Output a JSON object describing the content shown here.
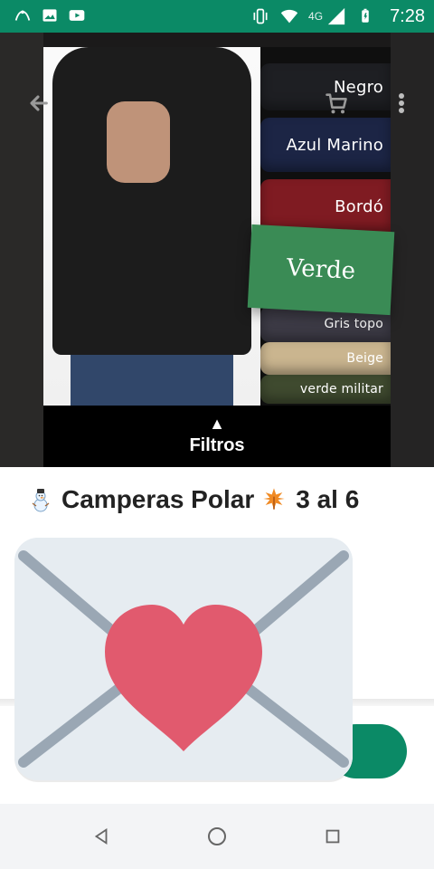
{
  "status_bar": {
    "time": "7:28",
    "network": "4G",
    "icons": [
      "assistant-icon",
      "image-icon",
      "youtube-icon",
      "vibrate-icon",
      "wifi-icon",
      "signal-icon",
      "battery-icon"
    ]
  },
  "hero": {
    "swatches": [
      {
        "label": "Negro",
        "color": "#1e1f23"
      },
      {
        "label": "Azul Marino",
        "color": "#1c2545"
      },
      {
        "label": "Bordó",
        "color": "#7f1b22"
      },
      {
        "label": "Verde",
        "color": "#3a8b55"
      },
      {
        "label": "Gris topo",
        "color": "#3d3b46"
      },
      {
        "label": "Beige",
        "color": "#cab58f"
      },
      {
        "label": "verde militar",
        "color": "#3f4a2f"
      }
    ],
    "filters_label": "Filtros"
  },
  "top_controls": {
    "back_icon": "arrow-back-icon",
    "cart_icon": "shopping-cart-icon",
    "menu_icon": "more-vert-icon"
  },
  "content": {
    "title_prefix_emoji": "snowman-icon",
    "title_text_part1": "Camperas Polar",
    "title_mid_emoji": "leaf-icon",
    "title_text_part2": "3 al 6"
  },
  "colors": {
    "accent": "#0b8a66",
    "card_bg": "#e6ecf1",
    "heart": "#e15a6e",
    "envelope_lines": "#9aa7b4"
  }
}
